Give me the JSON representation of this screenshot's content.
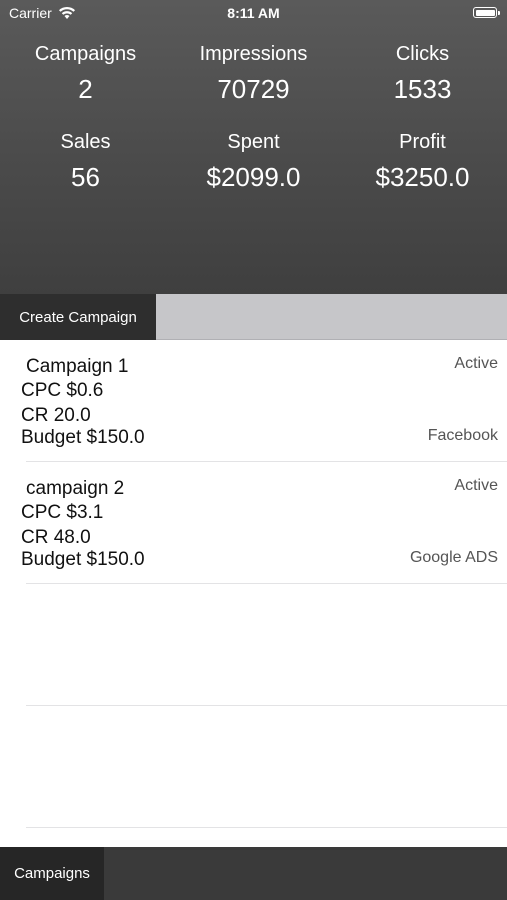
{
  "status_bar": {
    "carrier": "Carrier",
    "time": "8:11 AM"
  },
  "stats": [
    {
      "label": "Campaigns",
      "value": "2"
    },
    {
      "label": "Impressions",
      "value": "70729"
    },
    {
      "label": "Clicks",
      "value": "1533"
    },
    {
      "label": "Sales",
      "value": "56"
    },
    {
      "label": "Spent",
      "value": "$2099.0"
    },
    {
      "label": "Profit",
      "value": "$3250.0"
    }
  ],
  "toolbar": {
    "create_label": "Create Campaign"
  },
  "campaigns": [
    {
      "name": "Campaign 1",
      "cpc": "CPC $0.6",
      "cr": "CR 20.0",
      "budget": "Budget $150.0",
      "status": "Active",
      "platform": "Facebook"
    },
    {
      "name": "campaign 2",
      "cpc": "CPC $3.1",
      "cr": "CR 48.0",
      "budget": "Budget $150.0",
      "status": "Active",
      "platform": "Google ADS"
    }
  ],
  "tabbar": {
    "campaigns_label": "Campaigns"
  },
  "colors": {
    "header_bg": "#4c4c4c",
    "toolbar_bg": "#c6c6c9",
    "button_bg": "#2e2e2e",
    "tabbar_bg": "#3a3a3a"
  }
}
